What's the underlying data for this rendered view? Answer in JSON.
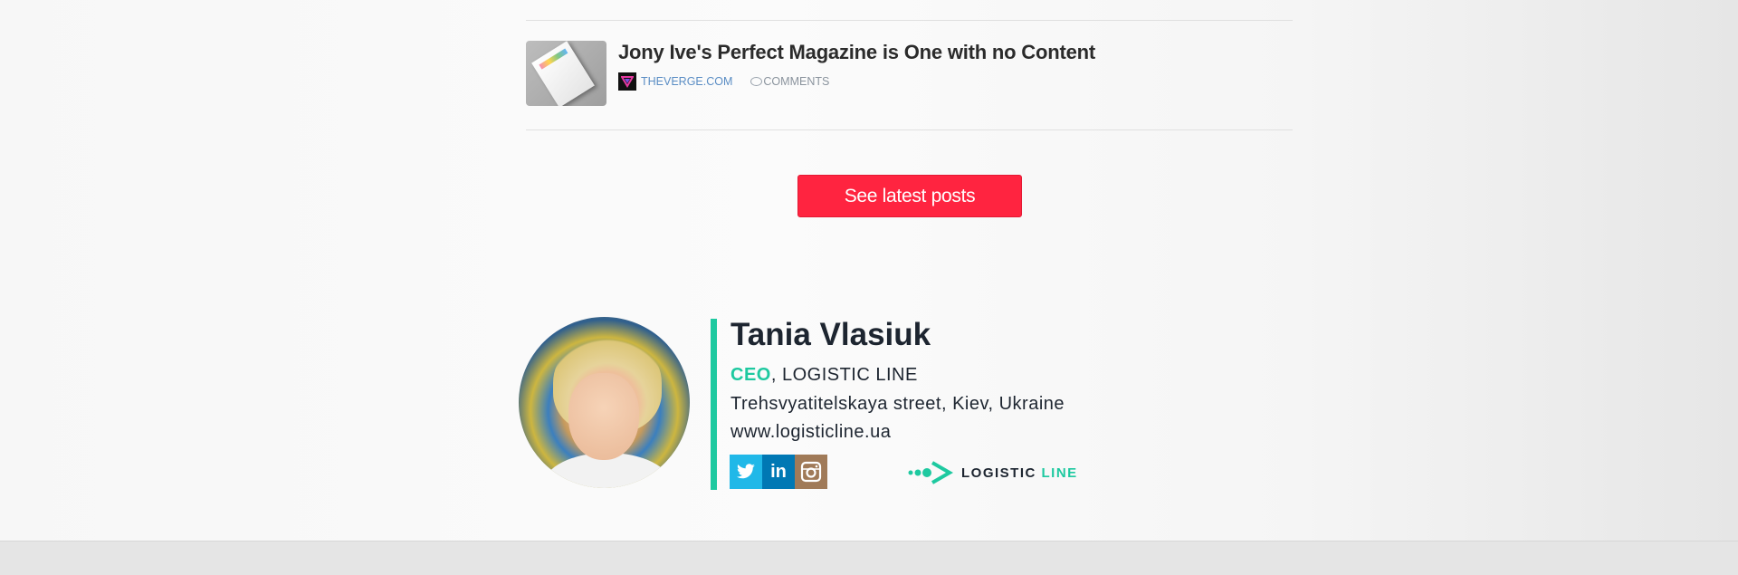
{
  "article": {
    "title": "Jony Ive's Perfect Magazine is One with no Content",
    "source": "THEVERGE.COM",
    "comments_label": "COMMENTS"
  },
  "button": {
    "label": "See latest posts"
  },
  "signature": {
    "name": "Tania Vlasiuk",
    "title": "CEO",
    "company": ", LOGISTIC LINE",
    "address": "Trehsvyatitelskaya street, Kiev, Ukraine",
    "website": "www.logisticline.ua",
    "linkedin_label": "in",
    "logo": {
      "word1": "LOGISTIC",
      "word2": " LINE"
    }
  },
  "colors": {
    "accent": "#1ec9a0",
    "button": "#ff2440",
    "link": "#5a8dc4",
    "twitter": "#20b8e8",
    "linkedin": "#0078b4",
    "instagram": "#a07a58"
  },
  "icons": [
    "verge-icon",
    "comment-icon",
    "twitter-icon",
    "linkedin-icon",
    "instagram-icon",
    "logistic-line-logo-icon"
  ]
}
